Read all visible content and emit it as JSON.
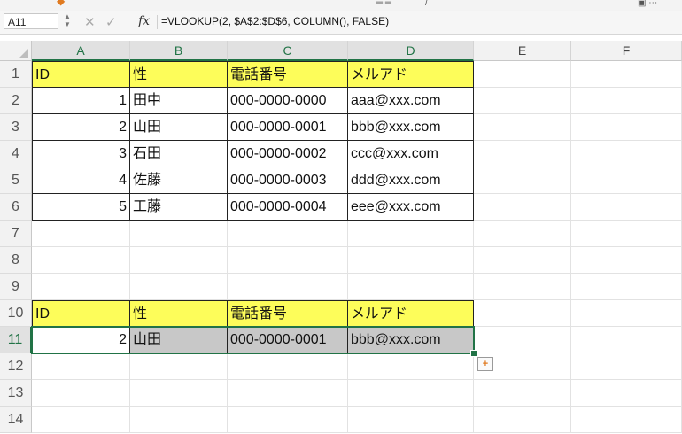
{
  "formula_bar": {
    "name_box": "A11",
    "formula": "=VLOOKUP(2, $A$2:$D$6, COLUMN(), FALSE)",
    "fx_label": "fx",
    "cancel_icon": "close-icon",
    "confirm_icon": "check-icon"
  },
  "columns": [
    "A",
    "B",
    "C",
    "D",
    "E",
    "F"
  ],
  "rows": [
    "1",
    "2",
    "3",
    "4",
    "5",
    "6",
    "7",
    "8",
    "9",
    "10",
    "11",
    "12",
    "13",
    "14"
  ],
  "table1": {
    "headers": [
      "ID",
      "性",
      "電話番号",
      "メルアド"
    ],
    "rows": [
      [
        "1",
        "田中",
        "000-0000-0000",
        "aaa@xxx.com"
      ],
      [
        "2",
        "山田",
        "000-0000-0001",
        "bbb@xxx.com"
      ],
      [
        "3",
        "石田",
        "000-0000-0002",
        "ccc@xxx.com"
      ],
      [
        "4",
        "佐藤",
        "000-0000-0003",
        "ddd@xxx.com"
      ],
      [
        "5",
        "工藤",
        "000-0000-0004",
        "eee@xxx.com"
      ]
    ]
  },
  "table2": {
    "headers": [
      "ID",
      "性",
      "電話番号",
      "メルアド"
    ],
    "result": [
      "2",
      "山田",
      "000-0000-0001",
      "bbb@xxx.com"
    ]
  },
  "selection": {
    "active_cell": "A11",
    "range": "A11:D11"
  },
  "colors": {
    "header_fill": "#fdfd5a",
    "selection_green": "#217346",
    "result_fill": "#c8c8c8"
  },
  "paste_options_icon": "paste-options-icon"
}
